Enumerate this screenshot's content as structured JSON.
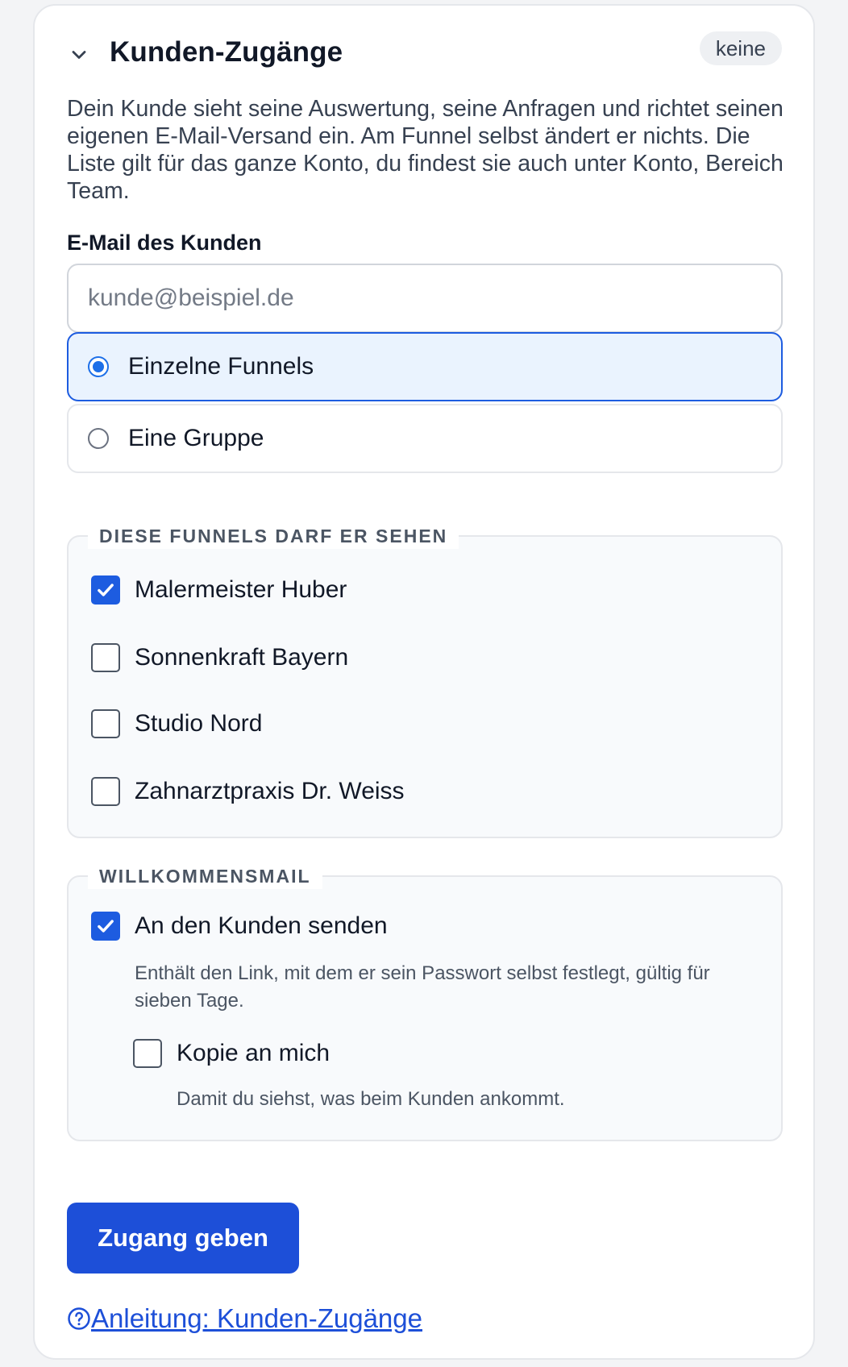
{
  "section": {
    "title": "Kunden-Zugänge",
    "badge": "keine",
    "description": "Dein Kunde sieht seine Auswertung, seine Anfragen und richtet seinen eigenen E-Mail-Versand ein. Am Funnel selbst ändert er nichts. Die Liste gilt für das ganze Konto, du findest sie auch unter Konto, Bereich Team."
  },
  "email": {
    "label": "E-Mail des Kunden",
    "placeholder": "kunde@beispiel.de",
    "value": ""
  },
  "scope": {
    "options": [
      {
        "label": "Einzelne Funnels",
        "selected": true
      },
      {
        "label": "Eine Gruppe",
        "selected": false
      }
    ]
  },
  "funnels": {
    "legend": "DIESE FUNNELS DARF ER SEHEN",
    "items": [
      {
        "label": "Malermeister Huber",
        "checked": true
      },
      {
        "label": "Sonnenkraft Bayern",
        "checked": false
      },
      {
        "label": "Studio Nord",
        "checked": false
      },
      {
        "label": "Zahnarztpraxis Dr. Weiss",
        "checked": false
      }
    ]
  },
  "welcome": {
    "legend": "WILLKOMMENSMAIL",
    "send": {
      "label": "An den Kunden senden",
      "checked": true,
      "hint": "Enthält den Link, mit dem er sein Passwort selbst festlegt, gültig für sieben Tage."
    },
    "copy": {
      "label": "Kopie an mich",
      "checked": false,
      "hint": "Damit du siehst, was beim Kunden ankommt."
    }
  },
  "actions": {
    "submit_label": "Zugang geben",
    "help_link": "Anleitung: Kunden-Zugänge"
  },
  "colors": {
    "accent": "#1d4fd8",
    "selected_bg": "#eaf3fe"
  }
}
